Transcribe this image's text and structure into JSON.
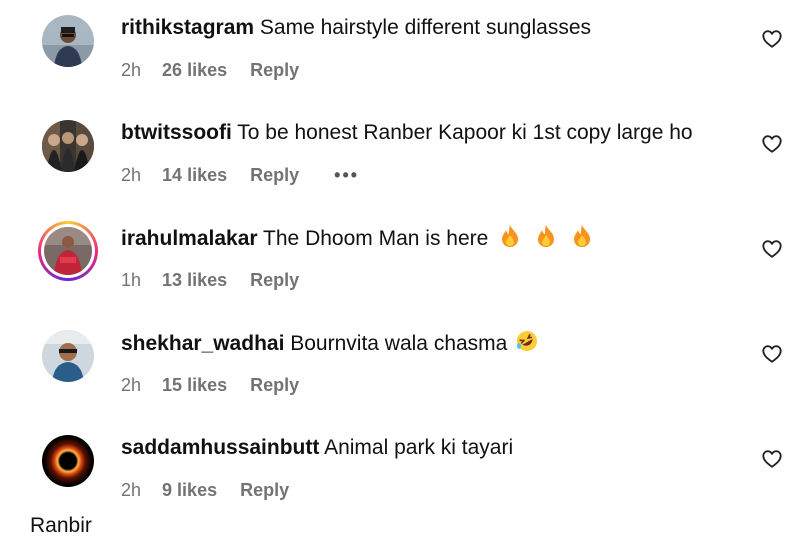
{
  "comments": [
    {
      "username": "rithikstagram",
      "text": "Same hairstyle different sunglasses",
      "time": "2h",
      "likes": "26 likes",
      "reply": "Reply",
      "avatar_icon": "profile-photo-icon"
    },
    {
      "username": "btwitssoofi",
      "text": "To be honest Ranber Kapoor ki 1st copy large ho",
      "time": "2h",
      "likes": "14 likes",
      "reply": "Reply",
      "more": "•••",
      "avatar_icon": "profile-photo-icon"
    },
    {
      "username": "irahulmalakar",
      "text": "The Dhoom Man is here",
      "emoji": [
        "fire-emoji",
        "fire-emoji",
        "fire-emoji"
      ],
      "time": "1h",
      "likes": "13 likes",
      "reply": "Reply",
      "avatar_icon": "profile-photo-story-ring-icon"
    },
    {
      "username": "shekhar_wadhai",
      "text": "Bournvita wala chasma",
      "emoji": [
        "rofl-emoji"
      ],
      "time": "2h",
      "likes": "15 likes",
      "reply": "Reply",
      "avatar_icon": "profile-photo-icon"
    },
    {
      "username": "saddamhussainbutt",
      "text": "Animal park ki tayari",
      "time": "2h",
      "likes": "9 likes",
      "reply": "Reply",
      "avatar_icon": "black-hole-photo-icon"
    }
  ],
  "like_icon": "heart-outline-icon",
  "cutoff_text": "Ranbir",
  "colors": {
    "text": "#111111",
    "meta": "#737373",
    "story_ring": [
      "#f9ce34",
      "#ee2a7b",
      "#6228d7"
    ]
  }
}
